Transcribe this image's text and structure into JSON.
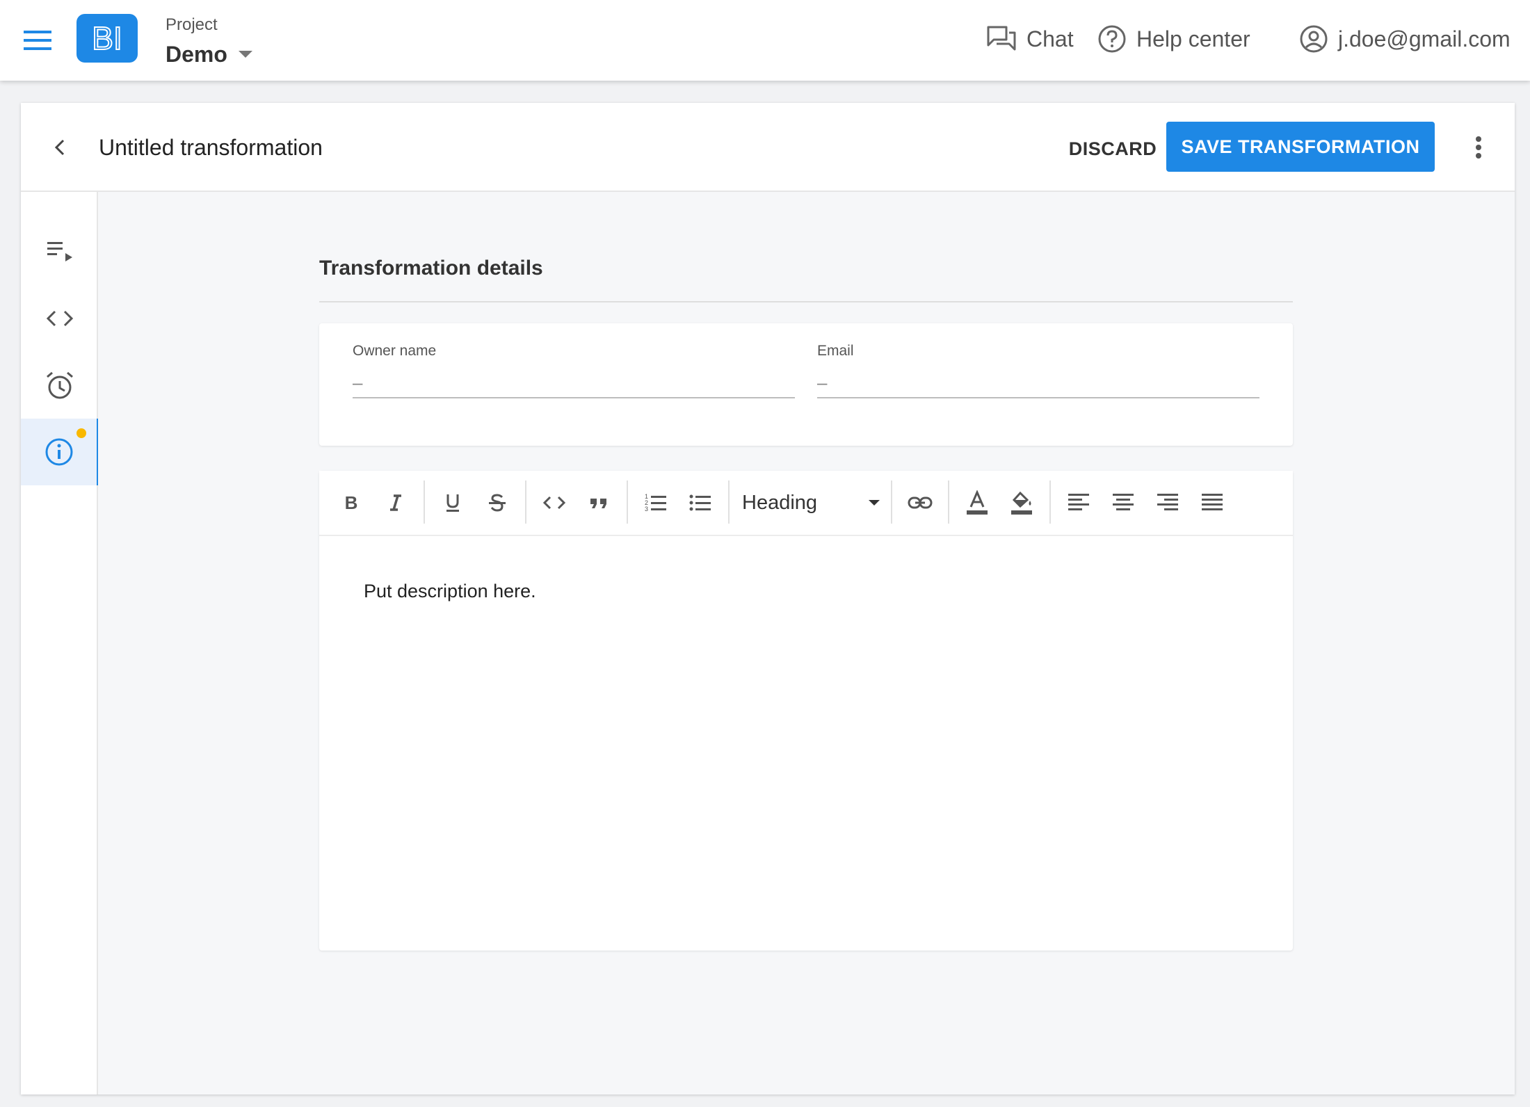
{
  "appbar": {
    "logo_text": "BI",
    "project_label": "Project",
    "project_name": "Demo",
    "chat_label": "Chat",
    "help_label": "Help center",
    "user_email": "j.doe@gmail.com"
  },
  "header": {
    "title": "Untitled transformation",
    "discard_label": "DISCARD",
    "save_label": "SAVE TRANSFORMATION"
  },
  "rail": {
    "items": [
      {
        "icon": "playlist-play-icon",
        "active": false
      },
      {
        "icon": "code-icon",
        "active": false
      },
      {
        "icon": "alarm-icon",
        "active": false
      },
      {
        "icon": "info-icon",
        "active": true,
        "badge": true
      }
    ]
  },
  "details": {
    "section_title": "Transformation details",
    "owner_label": "Owner name",
    "owner_value": "–",
    "email_label": "Email",
    "email_value": "–"
  },
  "editor": {
    "toolbar": [
      "bold-icon",
      "italic-icon",
      "underline-icon",
      "strikethrough-icon",
      "code-icon",
      "quote-icon",
      "numbered-list-icon",
      "bulleted-list-icon",
      "link-icon",
      "text-color-icon",
      "fill-color-icon",
      "align-left-icon",
      "align-center-icon",
      "align-right-icon",
      "align-justify-icon"
    ],
    "heading_value": "Heading",
    "description": "Put description here."
  },
  "colors": {
    "accent": "#1e88e5",
    "badge": "#f9b800"
  }
}
